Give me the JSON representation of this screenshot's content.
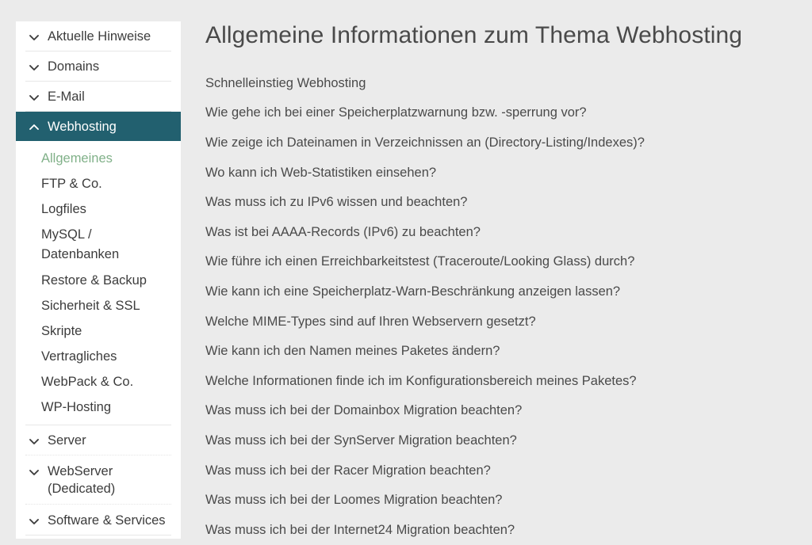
{
  "colors": {
    "page_background": "#ebebeb",
    "sidebar_background": "#ffffff",
    "active_item_background": "#22606f",
    "active_item_text": "#ffffff",
    "current_subitem_text": "#81b189",
    "text": "#4a4a4a"
  },
  "sidebar": {
    "items": [
      {
        "label": "Aktuelle Hinweise",
        "icon": "chevron-down-icon",
        "state": "collapsed",
        "multiline": false
      },
      {
        "label": "Domains",
        "icon": "chevron-down-icon",
        "state": "collapsed",
        "multiline": false
      },
      {
        "label": "E-Mail",
        "icon": "chevron-down-icon",
        "state": "collapsed",
        "multiline": false
      },
      {
        "label": "Webhosting",
        "icon": "chevron-up-icon",
        "state": "expanded",
        "multiline": false,
        "children": [
          {
            "label": "Allgemeines",
            "current": true,
            "multiline": false
          },
          {
            "label": "FTP & Co.",
            "current": false,
            "multiline": false
          },
          {
            "label": "Logfiles",
            "current": false,
            "multiline": false
          },
          {
            "label": "MySQL /\nDatenbanken",
            "current": false,
            "multiline": true
          },
          {
            "label": "Restore & Backup",
            "current": false,
            "multiline": false
          },
          {
            "label": "Sicherheit & SSL",
            "current": false,
            "multiline": false
          },
          {
            "label": "Skripte",
            "current": false,
            "multiline": false
          },
          {
            "label": "Vertragliches",
            "current": false,
            "multiline": false
          },
          {
            "label": "WebPack & Co.",
            "current": false,
            "multiline": false
          },
          {
            "label": "WP-Hosting",
            "current": false,
            "multiline": false
          }
        ]
      },
      {
        "label": "Server",
        "icon": "chevron-down-icon",
        "state": "collapsed",
        "multiline": false
      },
      {
        "label": "WebServer\n(Dedicated)",
        "icon": "chevron-down-icon",
        "state": "collapsed",
        "multiline": true
      },
      {
        "label": "Software & Services",
        "icon": "chevron-down-icon",
        "state": "collapsed",
        "multiline": false
      }
    ]
  },
  "main": {
    "title": "Allgemeine Informationen zum Thema Webhosting",
    "links": [
      "Schnelleinstieg Webhosting",
      "Wie gehe ich bei einer Speicherplatzwarnung bzw. -sperrung vor?",
      "Wie zeige ich Dateinamen in Verzeichnissen an (Directory-Listing/Indexes)?",
      "Wo kann ich Web-Statistiken einsehen?",
      "Was muss ich zu IPv6 wissen und beachten?",
      "Was ist bei AAAA-Records (IPv6) zu beachten?",
      "Wie führe ich einen Erreichbarkeitstest (Traceroute/Looking Glass) durch?",
      "Wie kann ich eine Speicherplatz-Warn-Beschränkung anzeigen lassen?",
      "Welche MIME-Types sind auf Ihren Webservern gesetzt?",
      "Wie kann ich den Namen meines Paketes ändern?",
      "Welche Informationen finde ich im Konfigurationsbereich meines Paketes?",
      "Was muss ich bei der Domainbox Migration beachten?",
      "Was muss ich bei der SynServer Migration beachten?",
      "Was muss ich bei der Racer Migration beachten?",
      "Was muss ich bei der Loomes Migration beachten?",
      "Was muss ich bei der Internet24 Migration beachten?"
    ]
  }
}
